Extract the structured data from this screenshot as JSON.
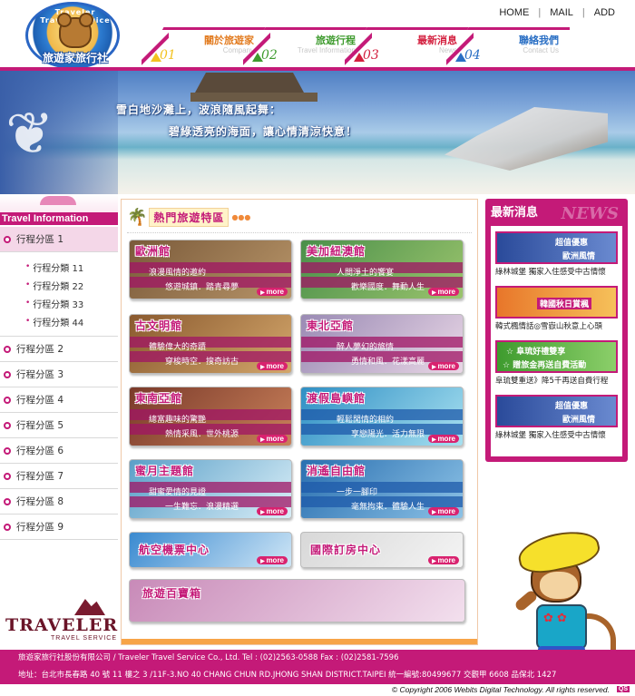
{
  "header": {
    "logo_text": "旅遊家旅行社",
    "logo_arc": "Traveler Travel Service",
    "toplinks": [
      "HOME",
      "MAIL",
      "ADD"
    ],
    "nav": [
      {
        "num": "01",
        "label": "關於旅遊家",
        "sub": "Company",
        "label_color": "#e27b1f",
        "tri_color": "#f2c221"
      },
      {
        "num": "02",
        "label": "旅遊行程",
        "sub": "Travel Information",
        "label_color": "#3e9b2e",
        "tri_color": "#3e9b2e"
      },
      {
        "num": "03",
        "label": "最新消息",
        "sub": "News",
        "label_color": "#d3203f",
        "tri_color": "#d3203f"
      },
      {
        "num": "04",
        "label": "聯絡我們",
        "sub": "Contact Us",
        "label_color": "#2a6fc4",
        "tri_color": "#2a6fc4"
      }
    ]
  },
  "banner": {
    "line1": "雪白地沙灘上，波浪隨風起舞：",
    "line2": "碧綠透亮的海面，讓心情清涼快意！"
  },
  "sidebar": {
    "title": "Travel Information",
    "active_zone": "行程分區 1",
    "sub_items": [
      "行程分類 11",
      "行程分類 22",
      "行程分類 33",
      "行程分類 44"
    ],
    "zones": [
      "行程分區 2",
      "行程分區 3",
      "行程分區 4",
      "行程分區 5",
      "行程分區 6",
      "行程分區 7",
      "行程分區 8",
      "行程分區 9"
    ],
    "logo_big": "TRAVELER",
    "logo_small": "TRAVEL SERVICE"
  },
  "center": {
    "title": "熱門旅遊特區",
    "more_label": "more",
    "cards": [
      {
        "name": "歐洲館",
        "line1": "浪漫風情的邀約",
        "line2": "悠遊城鎮．踏青尋夢",
        "colors": [
          "#7a5a3a",
          "#b79468"
        ]
      },
      {
        "name": "美加紐澳館",
        "line1": "人間淨土的饗宴",
        "line2": "歡樂國度．舞動人生",
        "colors": [
          "#4a8f4a",
          "#9bc46d"
        ]
      },
      {
        "name": "古文明館",
        "line1": "體驗偉大的奇蹟",
        "line2": "穿梭時空．搜奇訪古",
        "colors": [
          "#8a5a2f",
          "#d3a66b"
        ]
      },
      {
        "name": "東北亞館",
        "line1": "醉人夢幻的旅情",
        "line2": "勇情和風．花漾高麗",
        "colors": [
          "#9a8ab4",
          "#e9d7e6"
        ]
      },
      {
        "name": "東南亞館",
        "line1": "總富趣味的驚艷",
        "line2": "熱情采風．世外桃源",
        "colors": [
          "#7a3a2a",
          "#c9805a"
        ]
      },
      {
        "name": "渡假島嶼館",
        "line1": "輕鬆閒情的相約",
        "line2": "享戀陽光．活力無限",
        "colors": [
          "#2f8fc4",
          "#a7e0f0"
        ]
      },
      {
        "name": "蜜月主題館",
        "line1": "甜蜜愛情的見證",
        "line2": "一生難忘．浪漫精選",
        "colors": [
          "#5a9fc8",
          "#d9eef7"
        ]
      },
      {
        "name": "消遙自由館",
        "line1": "一步一腳印",
        "line2": "毫無拘束．體驗人生",
        "colors": [
          "#2a6fb0",
          "#8cc2e6"
        ]
      },
      {
        "name": "航空機票中心",
        "line1": "",
        "line2": "",
        "colors": [
          "#3a8ad0",
          "#cfe6f6"
        ]
      },
      {
        "name": "國際訂房中心",
        "line1": "",
        "line2": "",
        "colors": [
          "#d8d8d8",
          "#f4f4f4"
        ]
      },
      {
        "name": "旅遊百寶箱",
        "line1": "",
        "line2": "",
        "colors": [
          "#c88ab8",
          "#f3e0ee"
        ]
      }
    ]
  },
  "news": {
    "title": "最新消息",
    "title_en": "NEWS",
    "items": [
      {
        "t1": "超值優惠",
        "t2": "歐洲風情",
        "t3": "",
        "caption": "綠林城堡 獨家入住感受中古情懷",
        "colors": [
          "#2a4a9a",
          "#6a8ad0"
        ]
      },
      {
        "t1": "",
        "t2": "",
        "t3": "韓國秋日賞楓",
        "caption": "韓式楓情話◎雪嶽山秋意上心頭",
        "colors": [
          "#e8762a",
          "#f6c15a"
        ]
      },
      {
        "t1": "☆ 阜琉好禮雙享",
        "t2": "☆ 贈旅金再送自費活動",
        "t3": "",
        "caption": "阜琉雙重送》降5千再送自費行程",
        "colors": [
          "#3e9b2e",
          "#8ccf6a"
        ]
      },
      {
        "t1": "超值優惠",
        "t2": "歐洲風情",
        "t3": "",
        "caption": "綠林城堡 獨家入住感受中古情懷",
        "colors": [
          "#2a4a9a",
          "#6a8ad0"
        ]
      }
    ]
  },
  "footer": {
    "line1": "旅遊家旅行社股份有限公司 / Traveler Travel Service Co., Ltd.      Tel : (02)2563-0588          Fax : (02)2581-7596",
    "line2": "地址：台北市長春路 40 號 11 樓之 3  /11F-3.NO 40 CHANG CHUN RD.JHONG SHAN DISTRICT.TAIPEI   統一編號:80499677        交觀甲 6608   品保北 1427",
    "copyright": "© Copyright 2006 Webits Digital Technology. All rights reserved.",
    "badge": "QS"
  },
  "colors": {
    "accent": "#c41a78",
    "orange": "#f7a447"
  }
}
